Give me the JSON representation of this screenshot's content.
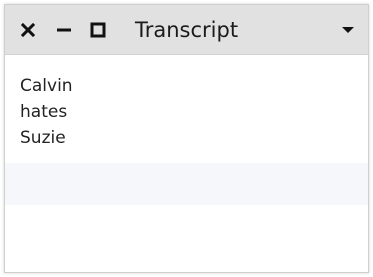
{
  "window": {
    "title": "Transcript",
    "controls": {
      "close_icon": "close-icon",
      "minimize_icon": "minimize-icon",
      "maximize_icon": "maximize-icon",
      "menu_icon": "dropdown-triangle-icon"
    }
  },
  "transcript": {
    "lines": [
      "Calvin",
      "hates",
      "Suzie"
    ]
  },
  "colors": {
    "titlebar": "#e1e1e1",
    "content_background": "#ffffff",
    "text": "#222222",
    "icon": "#111111"
  }
}
